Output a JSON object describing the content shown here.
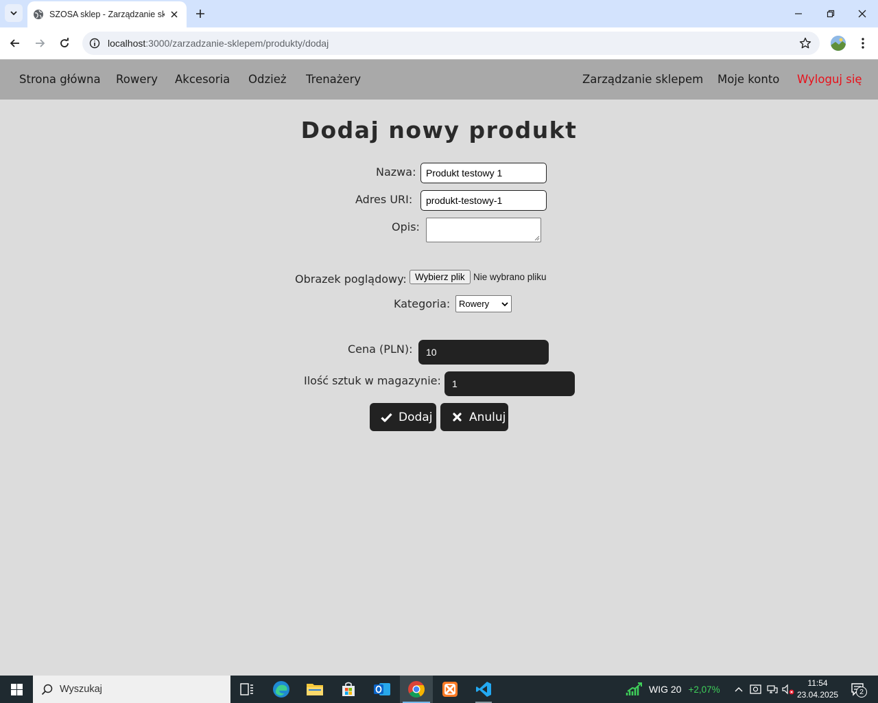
{
  "browser": {
    "tab_title": "SZOSA sklep - Zarządzanie sklepem",
    "url_host": "localhost",
    "url_path": ":3000/zarzadzanie-sklepem/produkty/dodaj"
  },
  "nav": {
    "left": [
      "Strona główna",
      "Rowery",
      "Akcesoria",
      "Odzież",
      "Trenażery"
    ],
    "right": [
      "Zarządzanie sklepem",
      "Moje konto",
      "Wyloguj się"
    ],
    "logout_color": "#e8101a"
  },
  "form": {
    "title": "Dodaj nowy produkt",
    "name_label": "Nazwa:",
    "name_value": "Produkt testowy 1",
    "uri_label": "Adres URI:",
    "uri_value": "produkt-testowy-1",
    "desc_label": "Opis:",
    "desc_value": "",
    "image_label": "Obrazek poglądowy:",
    "file_button": "Wybierz plik",
    "file_status": "Nie wybrano pliku",
    "category_label": "Kategoria:",
    "category_value": "Rowery",
    "price_label": "Cena (PLN):",
    "price_value": "10",
    "stock_label": "Ilość sztuk w magazynie:",
    "stock_value": "1",
    "submit_label": "Dodaj",
    "cancel_label": "Anuluj"
  },
  "taskbar": {
    "search_placeholder": "Wyszukaj",
    "stock_name": "WIG 20",
    "stock_change": "+2,07%",
    "time": "11:54",
    "date": "23.04.2025",
    "notifications": "2",
    "apps": [
      "task-view-icon",
      "edge-icon",
      "file-explorer-icon",
      "store-icon",
      "outlook-icon",
      "chrome-icon",
      "xampp-icon",
      "vscode-icon"
    ]
  }
}
